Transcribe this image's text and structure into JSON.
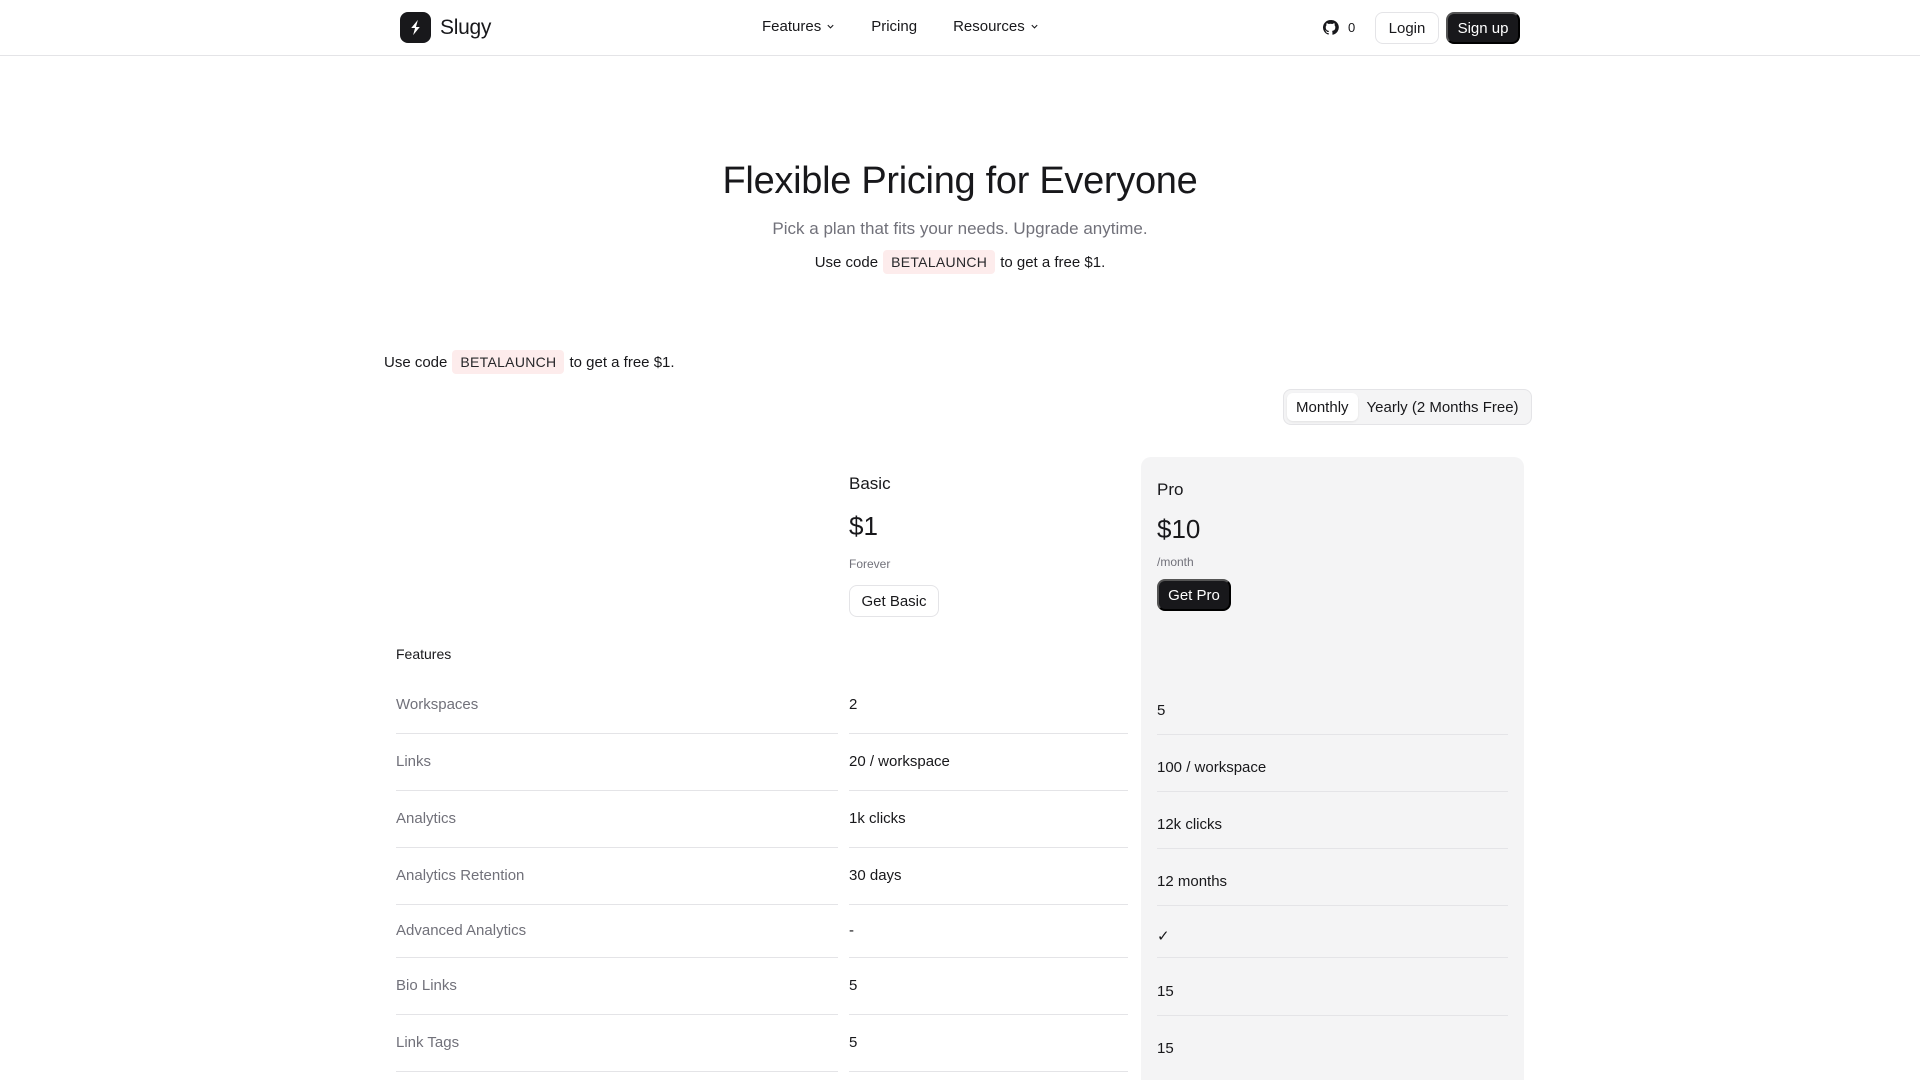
{
  "header": {
    "brand": "Slugy",
    "nav": [
      {
        "label": "Features",
        "has_dropdown": true
      },
      {
        "label": "Pricing",
        "has_dropdown": false
      },
      {
        "label": "Resources",
        "has_dropdown": true
      }
    ],
    "github_count": "0",
    "login_label": "Login",
    "signup_label": "Sign up"
  },
  "hero": {
    "title": "Flexible Pricing for Everyone",
    "subtitle": "Pick a plan that fits your needs. Upgrade anytime."
  },
  "promo": {
    "prefix": "Use code",
    "code": "BETALAUNCH",
    "suffix": "to get a free $1."
  },
  "billing_toggle": {
    "options": [
      "Monthly",
      "Yearly (2 Months Free)"
    ],
    "selected": "Monthly"
  },
  "plans": {
    "basic": {
      "name": "Basic",
      "price": "$1",
      "period": "Forever",
      "cta": "Get Basic"
    },
    "pro": {
      "name": "Pro",
      "price": "$10",
      "period": "/month",
      "cta": "Get Pro"
    }
  },
  "features_heading": "Features",
  "features": [
    {
      "label": "Workspaces",
      "basic": "2",
      "pro": "5"
    },
    {
      "label": "Links",
      "basic": "20 / workspace",
      "pro": "100 / workspace"
    },
    {
      "label": "Analytics",
      "basic": "1k clicks",
      "pro": "12k clicks"
    },
    {
      "label": "Analytics Retention",
      "basic": "30 days",
      "pro": "12 months"
    },
    {
      "label": "Advanced Analytics",
      "basic": "-",
      "pro": "✓"
    },
    {
      "label": "Bio Links",
      "basic": "5",
      "pro": "15"
    },
    {
      "label": "Link Tags",
      "basic": "5",
      "pro": "15"
    }
  ],
  "colors": {
    "primary": "#18181b",
    "muted_text": "#71717a",
    "border": "#e4e4e7",
    "pro_panel": "#f4f4f5",
    "code_bg": "#fdecec"
  }
}
